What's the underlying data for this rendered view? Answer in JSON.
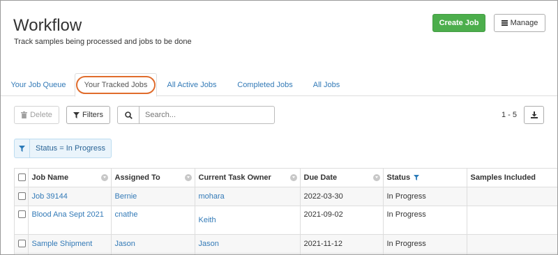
{
  "header": {
    "title": "Workflow",
    "subtitle": "Track samples being processed and jobs to be done",
    "create_job_label": "Create Job",
    "manage_label": "Manage"
  },
  "tabs": [
    {
      "label": "Your Job Queue",
      "active": false
    },
    {
      "label": "Your Tracked Jobs",
      "active": true
    },
    {
      "label": "All Active Jobs",
      "active": false
    },
    {
      "label": "Completed Jobs",
      "active": false
    },
    {
      "label": "All Jobs",
      "active": false
    }
  ],
  "toolbar": {
    "delete_label": "Delete",
    "filters_label": "Filters",
    "search_placeholder": "Search...",
    "pager_text": "1 - 5"
  },
  "active_filter": {
    "label": "Status = In Progress"
  },
  "grid": {
    "columns": [
      "Job Name",
      "Assigned To",
      "Current Task Owner",
      "Due Date",
      "Status",
      "Samples Included"
    ],
    "rows": [
      {
        "job_name": "Job 39144",
        "assigned_to": "Bernie",
        "task_owner": "mohara",
        "due_date": "2022-03-30",
        "status": "In Progress",
        "samples": ""
      },
      {
        "job_name": "Blood Ana Sept 2021",
        "assigned_to": "cnathe",
        "task_owner": "Keith",
        "due_date": "2021-09-02",
        "status": "In Progress",
        "samples": ""
      },
      {
        "job_name": "Sample Shipment",
        "assigned_to": "Jason",
        "task_owner": "Jason",
        "due_date": "2021-11-12",
        "status": "In Progress",
        "samples": ""
      }
    ]
  },
  "colors": {
    "primary_green": "#4cae4c",
    "link_blue": "#337ab7",
    "highlight_ring": "#e06c2c",
    "filter_chip_bg": "#eaf4fb"
  },
  "icons": [
    "trash-icon",
    "filter-icon",
    "search-icon",
    "download-icon",
    "bars-icon",
    "column-menu-icon"
  ]
}
